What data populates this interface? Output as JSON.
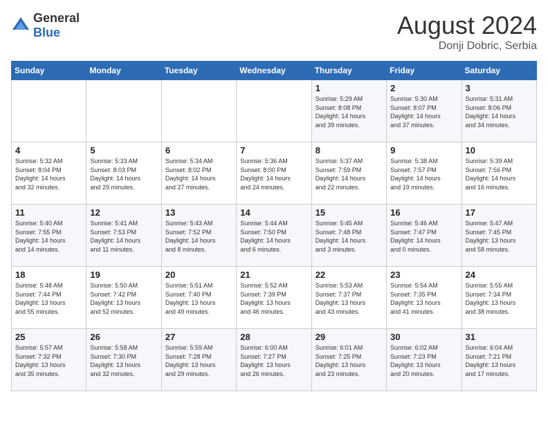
{
  "header": {
    "logo": {
      "text_general": "General",
      "text_blue": "Blue"
    },
    "title": "August 2024",
    "location": "Donji Dobric, Serbia"
  },
  "calendar": {
    "days_of_week": [
      "Sunday",
      "Monday",
      "Tuesday",
      "Wednesday",
      "Thursday",
      "Friday",
      "Saturday"
    ],
    "weeks": [
      [
        {
          "day": "",
          "info": ""
        },
        {
          "day": "",
          "info": ""
        },
        {
          "day": "",
          "info": ""
        },
        {
          "day": "",
          "info": ""
        },
        {
          "day": "1",
          "info": "Sunrise: 5:29 AM\nSunset: 8:08 PM\nDaylight: 14 hours\nand 39 minutes."
        },
        {
          "day": "2",
          "info": "Sunrise: 5:30 AM\nSunset: 8:07 PM\nDaylight: 14 hours\nand 37 minutes."
        },
        {
          "day": "3",
          "info": "Sunrise: 5:31 AM\nSunset: 8:06 PM\nDaylight: 14 hours\nand 34 minutes."
        }
      ],
      [
        {
          "day": "4",
          "info": "Sunrise: 5:32 AM\nSunset: 8:04 PM\nDaylight: 14 hours\nand 32 minutes."
        },
        {
          "day": "5",
          "info": "Sunrise: 5:33 AM\nSunset: 8:03 PM\nDaylight: 14 hours\nand 29 minutes."
        },
        {
          "day": "6",
          "info": "Sunrise: 5:34 AM\nSunset: 8:02 PM\nDaylight: 14 hours\nand 27 minutes."
        },
        {
          "day": "7",
          "info": "Sunrise: 5:36 AM\nSunset: 8:00 PM\nDaylight: 14 hours\nand 24 minutes."
        },
        {
          "day": "8",
          "info": "Sunrise: 5:37 AM\nSunset: 7:59 PM\nDaylight: 14 hours\nand 22 minutes."
        },
        {
          "day": "9",
          "info": "Sunrise: 5:38 AM\nSunset: 7:57 PM\nDaylight: 14 hours\nand 19 minutes."
        },
        {
          "day": "10",
          "info": "Sunrise: 5:39 AM\nSunset: 7:56 PM\nDaylight: 14 hours\nand 16 minutes."
        }
      ],
      [
        {
          "day": "11",
          "info": "Sunrise: 5:40 AM\nSunset: 7:55 PM\nDaylight: 14 hours\nand 14 minutes."
        },
        {
          "day": "12",
          "info": "Sunrise: 5:41 AM\nSunset: 7:53 PM\nDaylight: 14 hours\nand 11 minutes."
        },
        {
          "day": "13",
          "info": "Sunrise: 5:43 AM\nSunset: 7:52 PM\nDaylight: 14 hours\nand 8 minutes."
        },
        {
          "day": "14",
          "info": "Sunrise: 5:44 AM\nSunset: 7:50 PM\nDaylight: 14 hours\nand 6 minutes."
        },
        {
          "day": "15",
          "info": "Sunrise: 5:45 AM\nSunset: 7:48 PM\nDaylight: 14 hours\nand 3 minutes."
        },
        {
          "day": "16",
          "info": "Sunrise: 5:46 AM\nSunset: 7:47 PM\nDaylight: 14 hours\nand 0 minutes."
        },
        {
          "day": "17",
          "info": "Sunrise: 5:47 AM\nSunset: 7:45 PM\nDaylight: 13 hours\nand 58 minutes."
        }
      ],
      [
        {
          "day": "18",
          "info": "Sunrise: 5:48 AM\nSunset: 7:44 PM\nDaylight: 13 hours\nand 55 minutes."
        },
        {
          "day": "19",
          "info": "Sunrise: 5:50 AM\nSunset: 7:42 PM\nDaylight: 13 hours\nand 52 minutes."
        },
        {
          "day": "20",
          "info": "Sunrise: 5:51 AM\nSunset: 7:40 PM\nDaylight: 13 hours\nand 49 minutes."
        },
        {
          "day": "21",
          "info": "Sunrise: 5:52 AM\nSunset: 7:39 PM\nDaylight: 13 hours\nand 46 minutes."
        },
        {
          "day": "22",
          "info": "Sunrise: 5:53 AM\nSunset: 7:37 PM\nDaylight: 13 hours\nand 43 minutes."
        },
        {
          "day": "23",
          "info": "Sunrise: 5:54 AM\nSunset: 7:35 PM\nDaylight: 13 hours\nand 41 minutes."
        },
        {
          "day": "24",
          "info": "Sunrise: 5:55 AM\nSunset: 7:34 PM\nDaylight: 13 hours\nand 38 minutes."
        }
      ],
      [
        {
          "day": "25",
          "info": "Sunrise: 5:57 AM\nSunset: 7:32 PM\nDaylight: 13 hours\nand 35 minutes."
        },
        {
          "day": "26",
          "info": "Sunrise: 5:58 AM\nSunset: 7:30 PM\nDaylight: 13 hours\nand 32 minutes."
        },
        {
          "day": "27",
          "info": "Sunrise: 5:59 AM\nSunset: 7:28 PM\nDaylight: 13 hours\nand 29 minutes."
        },
        {
          "day": "28",
          "info": "Sunrise: 6:00 AM\nSunset: 7:27 PM\nDaylight: 13 hours\nand 26 minutes."
        },
        {
          "day": "29",
          "info": "Sunrise: 6:01 AM\nSunset: 7:25 PM\nDaylight: 13 hours\nand 23 minutes."
        },
        {
          "day": "30",
          "info": "Sunrise: 6:02 AM\nSunset: 7:23 PM\nDaylight: 13 hours\nand 20 minutes."
        },
        {
          "day": "31",
          "info": "Sunrise: 6:04 AM\nSunset: 7:21 PM\nDaylight: 13 hours\nand 17 minutes."
        }
      ]
    ]
  }
}
